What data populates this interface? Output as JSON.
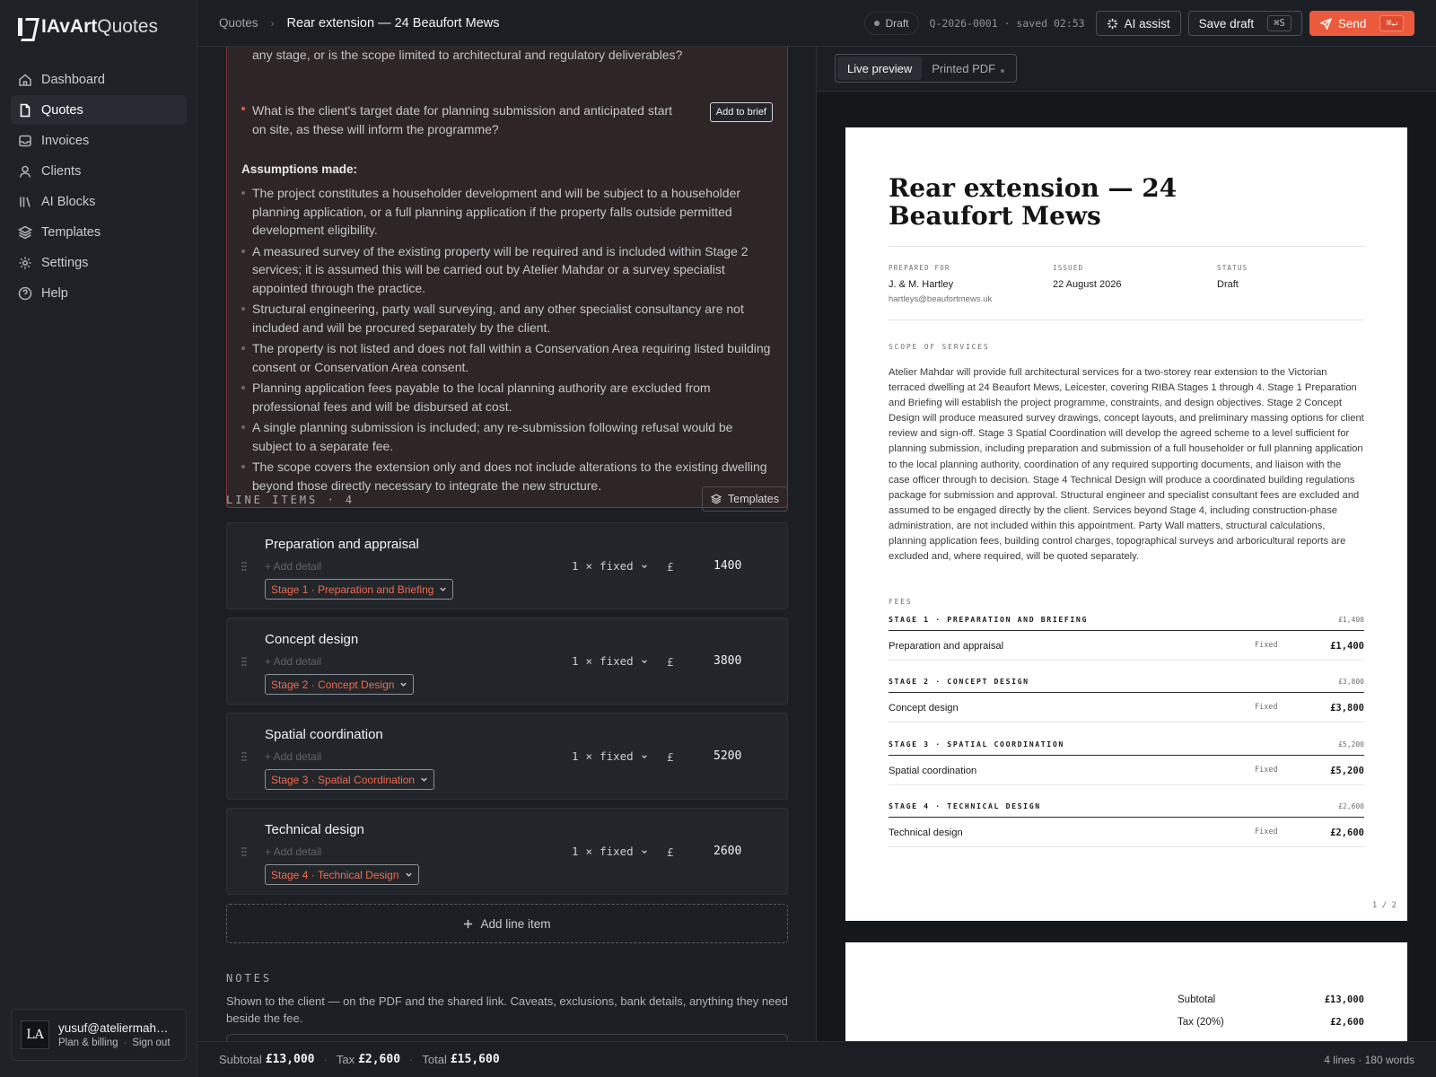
{
  "sidebar": {
    "logo": {
      "bold": "IAvArt",
      "rest": "Quotes"
    },
    "items": [
      {
        "label": "Dashboard",
        "icon": "home-icon",
        "active": false
      },
      {
        "label": "Quotes",
        "icon": "document-icon",
        "active": true
      },
      {
        "label": "Invoices",
        "icon": "inbox-icon",
        "active": false
      },
      {
        "label": "Clients",
        "icon": "user-icon",
        "active": false
      },
      {
        "label": "AI Blocks",
        "icon": "blocks-icon",
        "active": false
      },
      {
        "label": "Templates",
        "icon": "layers-icon",
        "active": false
      },
      {
        "label": "Settings",
        "icon": "gear-icon",
        "active": false
      },
      {
        "label": "Help",
        "icon": "help-icon",
        "active": false
      }
    ],
    "account": {
      "initials": "LA",
      "email": "yusuf@ateliermahdar.co.uk",
      "plan_link": "Plan & billing",
      "signout_link": "Sign out"
    }
  },
  "topbar": {
    "breadcrumb_root": "Quotes",
    "breadcrumb_current": "Rear extension — 24 Beaufort Mews",
    "status": "Draft",
    "quote_meta": "Q-2026-0001 · saved 02:53",
    "ai_assist": "AI assist",
    "save_draft": "Save draft",
    "save_shortcut": "⌘S",
    "send": "Send",
    "send_shortcut": "⌘↵"
  },
  "brief": {
    "question_partial": "any stage, or is the scope limited to architectural and regulatory deliverables?",
    "question": "What is the client's target date for planning submission and anticipated start on site, as these will inform the programme?",
    "add_to_brief": "Add to brief",
    "assumptions_heading": "Assumptions made:",
    "assumptions": [
      "The project constitutes a householder development and will be subject to a householder planning application, or a full planning application if the property falls outside permitted development eligibility.",
      "A measured survey of the existing property will be required and is included within Stage 2 services; it is assumed this will be carried out by Atelier Mahdar or a survey specialist appointed through the practice.",
      "Structural engineering, party wall surveying, and any other specialist consultancy are not included and will be procured separately by the client.",
      "The property is not listed and does not fall within a Conservation Area requiring listed building consent or Conservation Area consent.",
      "Planning application fees payable to the local planning authority are excluded from professional fees and will be disbursed at cost.",
      "A single planning submission is included; any re-submission following refusal would be subject to a separate fee.",
      "The scope covers the extension only and does not include alterations to the existing dwelling beyond those directly necessary to integrate the new structure."
    ]
  },
  "line_items": {
    "heading": "LINE ITEMS · 4",
    "templates_button": "Templates",
    "add_detail": "+ Add detail",
    "items": [
      {
        "name": "Preparation and appraisal",
        "stage": "Stage 1 · Preparation and Briefing",
        "qty": "1",
        "times": "×",
        "unit": "fixed",
        "currency": "£",
        "amount": "1400"
      },
      {
        "name": "Concept design",
        "stage": "Stage 2 · Concept Design",
        "qty": "1",
        "times": "×",
        "unit": "fixed",
        "currency": "£",
        "amount": "3800"
      },
      {
        "name": "Spatial coordination",
        "stage": "Stage 3 · Spatial Coordination",
        "qty": "1",
        "times": "×",
        "unit": "fixed",
        "currency": "£",
        "amount": "5200"
      },
      {
        "name": "Technical design",
        "stage": "Stage 4 · Technical Design",
        "qty": "1",
        "times": "×",
        "unit": "fixed",
        "currency": "£",
        "amount": "2600"
      }
    ],
    "add_line_item": "Add line item"
  },
  "notes": {
    "heading": "NOTES",
    "description": "Shown to the client — on the PDF and the shared link. Caveats, exclusions, bank details, anything they need beside the fee."
  },
  "bottombar": {
    "subtotal_label": "Subtotal",
    "subtotal": "£13,000",
    "tax_label": "Tax",
    "tax": "£2,600",
    "total_label": "Total",
    "total": "£15,600",
    "stats": "4 lines · 180 words"
  },
  "preview": {
    "tab_live": "Live preview",
    "tab_pdf": "Printed PDF",
    "title": "Rear extension — 24 Beaufort Mews",
    "prepared_for_label": "PREPARED FOR",
    "client_name": "J. & M. Hartley",
    "client_email": "hartleys@beaufortmews.uk",
    "issued_label": "ISSUED",
    "issued": "22 August 2026",
    "status_label": "STATUS",
    "status": "Draft",
    "scope_label": "SCOPE OF SERVICES",
    "scope": "Atelier Mahdar will provide full architectural services for a two-storey rear extension to the Victorian terraced dwelling at 24 Beaufort Mews, Leicester, covering RIBA Stages 1 through 4. Stage 1 Preparation and Briefing will establish the project programme, constraints, and design objectives. Stage 2 Concept Design will produce measured survey drawings, concept layouts, and preliminary massing options for client review and sign-off. Stage 3 Spatial Coordination will develop the agreed scheme to a level sufficient for planning submission, including preparation and submission of a full householder or full planning application to the local planning authority, coordination of any required supporting documents, and liaison with the case officer through to decision. Stage 4 Technical Design will produce a coordinated building regulations package for submission and approval. Structural engineer and specialist consultant fees are excluded and assumed to be engaged directly by the client. Services beyond Stage 4, including construction-phase administration, are not included within this appointment. Party Wall matters, structural calculations, planning application fees, building control charges, topographical surveys and arboricultural reports are excluded and, where required, will be quoted separately.",
    "fees_label": "FEES",
    "fees": [
      {
        "stage": "STAGE 1 · PREPARATION AND BRIEFING",
        "stage_total": "£1,400",
        "name": "Preparation and appraisal",
        "type": "Fixed",
        "amount": "£1,400"
      },
      {
        "stage": "STAGE 2 · CONCEPT DESIGN",
        "stage_total": "£3,800",
        "name": "Concept design",
        "type": "Fixed",
        "amount": "£3,800"
      },
      {
        "stage": "STAGE 3 · SPATIAL COORDINATION",
        "stage_total": "£5,200",
        "name": "Spatial coordination",
        "type": "Fixed",
        "amount": "£5,200"
      },
      {
        "stage": "STAGE 4 · TECHNICAL DESIGN",
        "stage_total": "£2,600",
        "name": "Technical design",
        "type": "Fixed",
        "amount": "£2,600"
      }
    ],
    "page_number": "1 / 2",
    "subtotal_label": "Subtotal",
    "subtotal": "£13,000",
    "tax_label": "Tax (20%)",
    "tax": "£2,600"
  }
}
